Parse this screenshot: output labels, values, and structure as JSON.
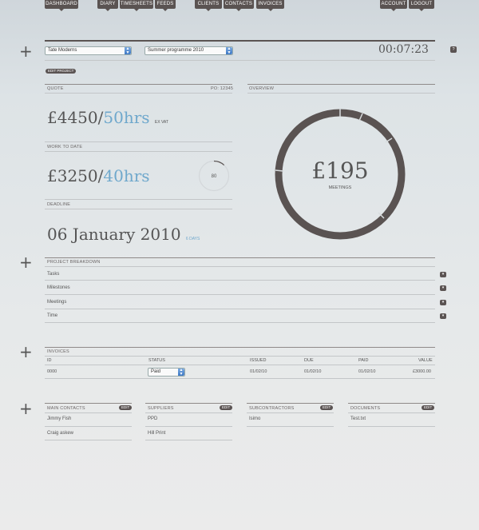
{
  "nav": {
    "dashboard": "DASHBOARD",
    "diary": "DIARY",
    "timesheets": "TIMESHEETS",
    "feeds": "FEEDS",
    "clients": "CLIENTS",
    "contacts": "CONTACTS",
    "invoices": "INVOICES",
    "account": "ACCOUNT",
    "logout": "LOGOUT"
  },
  "header": {
    "client": "Tate Moderns",
    "project": "Summer programme 2010",
    "timer": "00:07:23",
    "help": "?",
    "edit_project": "EDIT PROJECT"
  },
  "quote": {
    "label": "QUOTE",
    "po": "PO: 12345",
    "amount": "£4450",
    "slash": "/",
    "hours": "50hrs",
    "vat": "EX VAT"
  },
  "work": {
    "label": "WORK TO DATE",
    "amount": "£3250",
    "slash": "/",
    "hours": "40hrs",
    "progress": "80",
    "progress_fraction": 0.8
  },
  "deadline": {
    "label": "DEADLINE",
    "date": "06 January 2010",
    "days": "6 DAYS"
  },
  "overview": {
    "label": "OVERVIEW",
    "amount": "£195",
    "sublabel": "MEETINGS"
  },
  "breakdown": {
    "label": "PROJECT BREAKDOWN",
    "items": [
      "Tasks",
      "Milestones",
      "Meetings",
      "Time"
    ]
  },
  "invoices": {
    "label": "INVOICES",
    "columns": [
      "ID",
      "STATUS",
      "ISSUED",
      "DUE",
      "PAID",
      "VALUE"
    ],
    "rows": [
      {
        "id": "0000",
        "status": "Paid",
        "issued": "01/02/10",
        "due": "01/02/10",
        "paid": "01/02/10",
        "value": "£3000.00"
      }
    ]
  },
  "contacts": {
    "edit": "EDIT",
    "main": {
      "label": "MAIN CONTACTS",
      "items": [
        "Jimmy Fish",
        "Craig askew"
      ]
    },
    "suppliers": {
      "label": "SUPPLIERS",
      "items": [
        "PPD",
        "Hill Print"
      ]
    },
    "subcontractors": {
      "label": "SUBCONTRACTORS",
      "items": [
        "Isimo"
      ]
    },
    "documents": {
      "label": "DOCUMENTS",
      "items": [
        "Test.txt"
      ]
    }
  },
  "colors": {
    "dark": "#5a5352",
    "accent_blue": "#6fa8cc"
  }
}
